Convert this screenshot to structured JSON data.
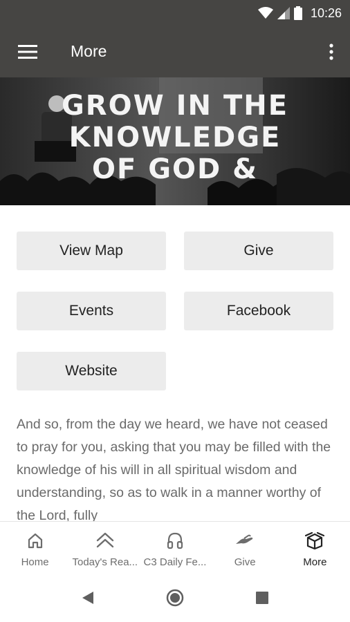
{
  "status_bar": {
    "time": "10:26"
  },
  "app_bar": {
    "title": "More",
    "menu_icon": "hamburger-menu-icon",
    "overflow_icon": "more-vert-icon"
  },
  "hero": {
    "lines": [
      "GROW IN THE",
      "KNOWLEDGE",
      "OF GOD &"
    ]
  },
  "buttons": {
    "view_map": "View Map",
    "give": "Give",
    "events": "Events",
    "facebook": "Facebook",
    "website": "Website"
  },
  "verse": "And so, from the day we heard, we have not ceased to pray for you, asking that you may be filled with the knowledge of his will in all spiritual wisdom and understanding, so as to walk in a manner worthy of the Lord, fully",
  "bottom_nav": [
    {
      "label": "Home",
      "icon": "home-icon"
    },
    {
      "label": "Today's Rea...",
      "icon": "chevrons-up-icon"
    },
    {
      "label": "C3 Daily Fe...",
      "icon": "headphones-icon"
    },
    {
      "label": "Give",
      "icon": "give-hand-icon"
    },
    {
      "label": "More",
      "icon": "box-icon"
    }
  ],
  "colors": {
    "app_bar": "#464543",
    "button_bg": "#ececec",
    "verse_text": "#6a6a6a"
  }
}
